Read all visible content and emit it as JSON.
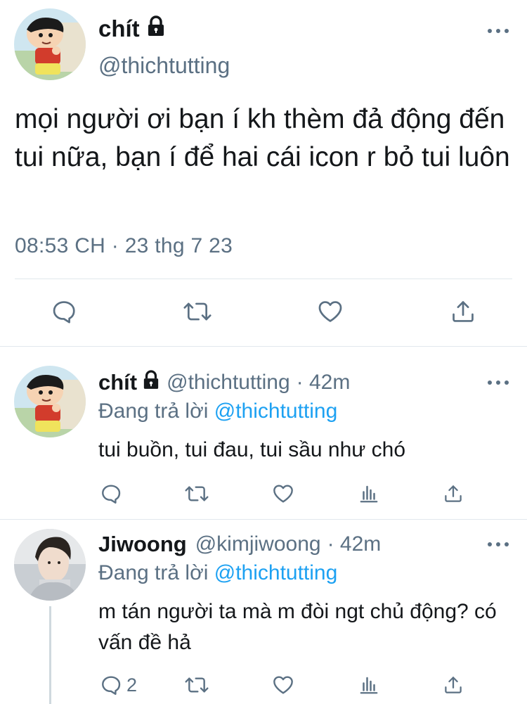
{
  "main_tweet": {
    "name": "chít",
    "handle": "@thichtutting",
    "text": "mọi người ơi bạn í kh thèm đả động đến tui nữa, bạn í để hai cái icon r bỏ tui luôn",
    "timestamp": "08:53 CH · 23 thg 7 23",
    "avatar_icon": "cartoon-boy-avatar",
    "actions": [
      "reply-icon",
      "retweet-icon",
      "like-icon",
      "share-icon"
    ]
  },
  "replies": [
    {
      "name": "chít",
      "handle": "@thichtutting",
      "time": "· 42m",
      "replying_prefix": "Đang trả lời",
      "replying_to": "@thichtutting",
      "text": "tui buồn, tui đau, tui sầu như chó",
      "reply_count": "",
      "avatar_icon": "cartoon-boy-avatar"
    },
    {
      "name": "Jiwoong",
      "handle": "@kimjiwoong",
      "time": "· 42m",
      "replying_prefix": "Đang trả lời",
      "replying_to": "@thichtutting",
      "text": "m tán người ta mà m đòi ngt chủ động? có vấn đề hả",
      "reply_count": "2",
      "avatar_icon": "person-photo-avatar"
    }
  ],
  "colors": {
    "text": "#14171a",
    "muted": "#5b7083",
    "link": "#1da1f2",
    "divider": "#e1e8ed"
  }
}
